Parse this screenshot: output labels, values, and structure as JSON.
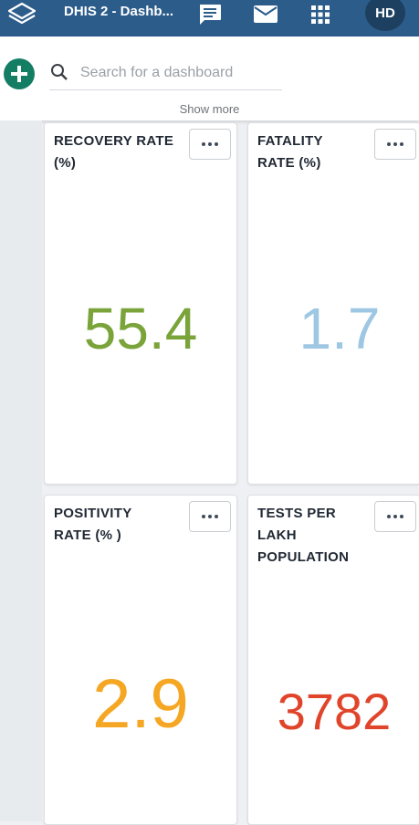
{
  "header": {
    "app_title": "DHIS 2 - Dashb...",
    "user_initials": "HD"
  },
  "toolbar": {
    "search_placeholder": "Search for a dashboard",
    "show_more_label": "Show more"
  },
  "items": [
    {
      "title_line1": "RECOVERY RATE",
      "title_line2": "(%)",
      "title_line3": "",
      "value": "55.4",
      "color": "#7aa43a"
    },
    {
      "title_line1": "FATALITY",
      "title_line2": "RATE (%)",
      "title_line3": "",
      "value": "1.7",
      "color": "#9ec7e3"
    },
    {
      "title_line1": "POSITIVITY",
      "title_line2": "RATE (% )",
      "title_line3": "",
      "value": "2.9",
      "color": "#f5a623"
    },
    {
      "title_line1": "TESTS PER",
      "title_line2": "LAKH",
      "title_line3": "POPULATION",
      "value": "3782",
      "color": "#e0452b"
    }
  ],
  "colors": {
    "header_bg": "#2b5c8a",
    "add_button": "#147e64"
  },
  "icons": [
    "dhis2-logo-icon",
    "message-icon",
    "mail-icon",
    "apps-grid-icon",
    "plus-icon",
    "search-icon",
    "more-horizontal-icon"
  ]
}
